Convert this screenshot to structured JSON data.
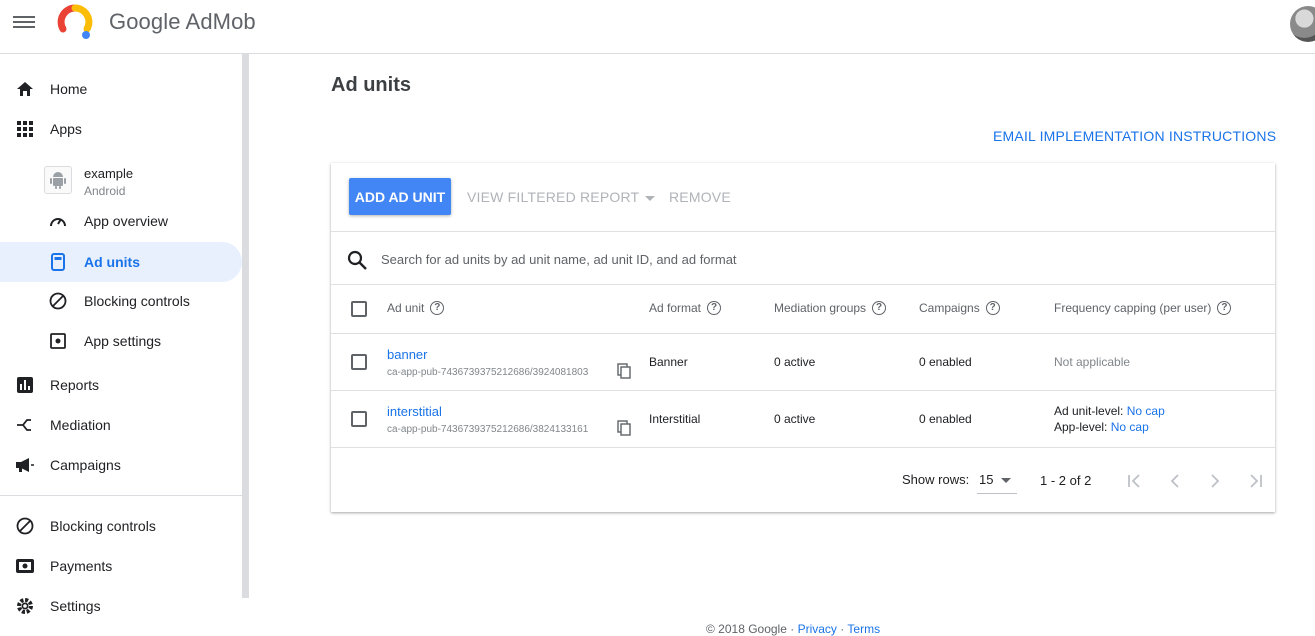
{
  "app": {
    "brand": "Google AdMob"
  },
  "sidebar": {
    "home": "Home",
    "apps": "Apps",
    "app_entry": {
      "name": "example",
      "platform": "Android"
    },
    "app_overview": "App overview",
    "ad_units": "Ad units",
    "blocking_controls_app": "Blocking controls",
    "app_settings": "App settings",
    "reports": "Reports",
    "mediation": "Mediation",
    "campaigns": "Campaigns",
    "blocking_controls": "Blocking controls",
    "payments": "Payments",
    "settings": "Settings"
  },
  "main": {
    "title": "Ad units",
    "email_link": "EMAIL IMPLEMENTATION INSTRUCTIONS",
    "toolbar": {
      "add": "ADD AD UNIT",
      "view_report": "VIEW FILTERED REPORT",
      "remove": "REMOVE"
    },
    "search": {
      "placeholder": "Search for ad units by ad unit name, ad unit ID, and ad format"
    },
    "columns": {
      "ad_unit": "Ad unit",
      "ad_format": "Ad format",
      "mediation": "Mediation groups",
      "campaigns": "Campaigns",
      "frequency": "Frequency capping (per user)"
    },
    "rows": [
      {
        "name": "banner",
        "id": "ca-app-pub-7436739375212686/3924081803",
        "format": "Banner",
        "mediation": "0 active",
        "campaigns": "0 enabled",
        "frequency": "Not applicable"
      },
      {
        "name": "interstitial",
        "id": "ca-app-pub-7436739375212686/3824133161",
        "format": "Interstitial",
        "mediation": "0 active",
        "campaigns": "0 enabled",
        "freq_unit_label": "Ad unit-level:",
        "freq_unit_value": "No cap",
        "freq_app_label": "App-level:",
        "freq_app_value": "No cap"
      }
    ],
    "pagination": {
      "show_rows_label": "Show rows:",
      "rows_value": "15",
      "range": "1 - 2 of 2"
    }
  },
  "footer": {
    "copyright": "© 2018 Google",
    "privacy": "Privacy",
    "terms": "Terms"
  },
  "colors": {
    "accent": "#1a73e8",
    "primary_button": "#4285f4",
    "active_nav_bg": "#e8f0fe"
  }
}
